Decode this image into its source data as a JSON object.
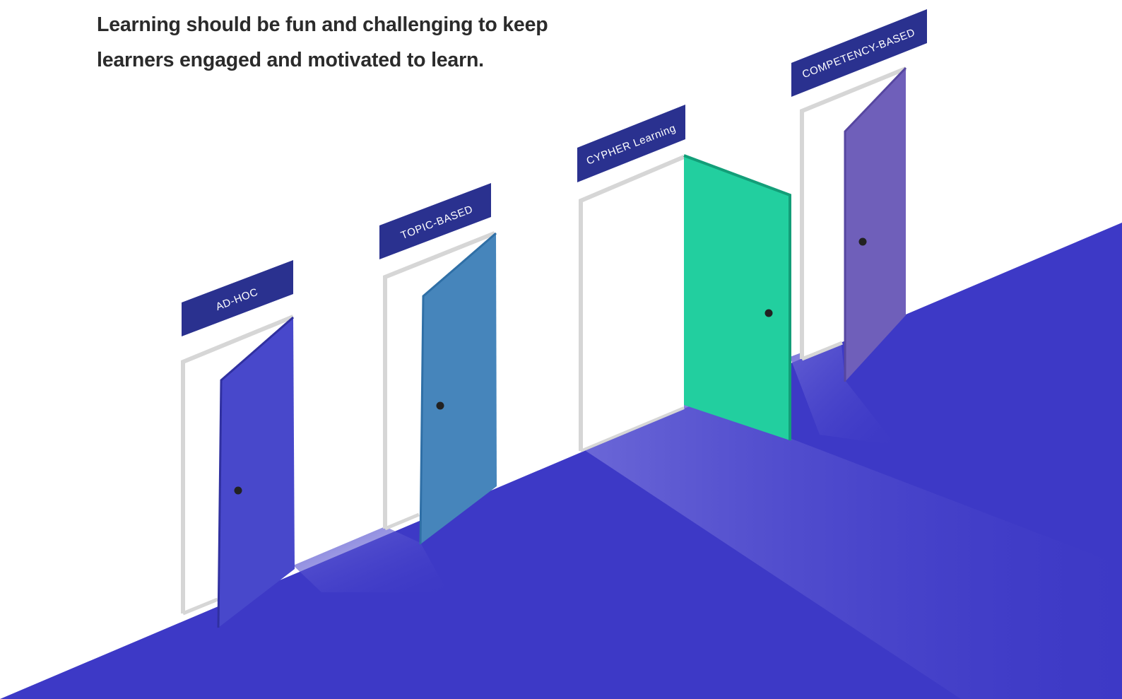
{
  "headline": {
    "line1": "Learning should be fun and challenging to keep",
    "line2": "learners engaged and motivated to learn."
  },
  "doors": [
    {
      "label": "AD-HOC",
      "color": "#4848CB"
    },
    {
      "label": "TOPIC-BASED",
      "color": "#4685BB"
    },
    {
      "label": "CYPHER Learning",
      "color": "#22CF9F"
    },
    {
      "label": "COMPETENCY-BASED",
      "color": "#6F5FBA"
    }
  ],
  "colors": {
    "floor": "#3D39C6",
    "sign": "#2A318F",
    "frame": "#D6D6D6",
    "knob": "#222222"
  }
}
